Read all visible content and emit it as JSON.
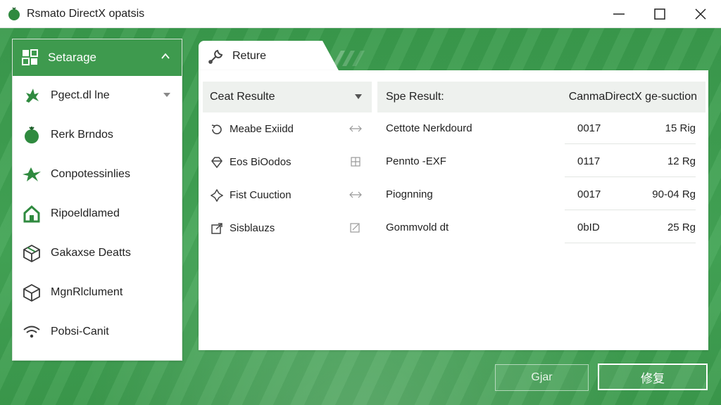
{
  "window": {
    "title": "Rsmato DirectX opatsis"
  },
  "sidebar": {
    "header": {
      "label": "Setarage",
      "icon": "grid-settings-icon"
    },
    "items": [
      {
        "label": "Pgect.dl lne",
        "icon": "gecko-icon",
        "has_dropdown": true
      },
      {
        "label": "Rerk Brndos",
        "icon": "tomato-icon"
      },
      {
        "label": "Conpotessinlies",
        "icon": "lizard-icon"
      },
      {
        "label": "Ripoeldlamed",
        "icon": "home-icon"
      },
      {
        "label": "Gakaxse Deatts",
        "icon": "box-icon"
      },
      {
        "label": "MgnRlclument",
        "icon": "cube-icon"
      },
      {
        "label": "Pobsi-Canit",
        "icon": "wifi-icon"
      }
    ]
  },
  "tab": {
    "label": "Reture",
    "icon": "wrench-icon"
  },
  "left_panel": {
    "select_label": "Ceat Resulte",
    "items": [
      {
        "label": "Meabe Exiidd",
        "icon": "refresh-icon"
      },
      {
        "label": "Eos BiOodos",
        "icon": "gem-icon"
      },
      {
        "label": "Fist Cuuction",
        "icon": "puzzle-icon"
      },
      {
        "label": "Sisblauzs",
        "icon": "external-icon"
      }
    ]
  },
  "right_panel": {
    "header_left": "Spe Result:",
    "header_right": "CanmaDirectX ge-suction",
    "rows": [
      {
        "name": "Cettote Nerkdourd",
        "code": "0017",
        "value": "15 Rig"
      },
      {
        "name": "Pennto -EXF",
        "code": "0117",
        "value": "12 Rg"
      },
      {
        "name": "Piognning",
        "code": "0017",
        "value": "90-04 Rg"
      },
      {
        "name": "Gommvold dt",
        "code": "0bID",
        "value": "25 Rg"
      }
    ]
  },
  "buttons": {
    "secondary": "Gjar",
    "primary": "修复"
  },
  "colors": {
    "accent": "#3e9a4e",
    "background": "#3f9a4f",
    "panel": "#ffffff"
  }
}
